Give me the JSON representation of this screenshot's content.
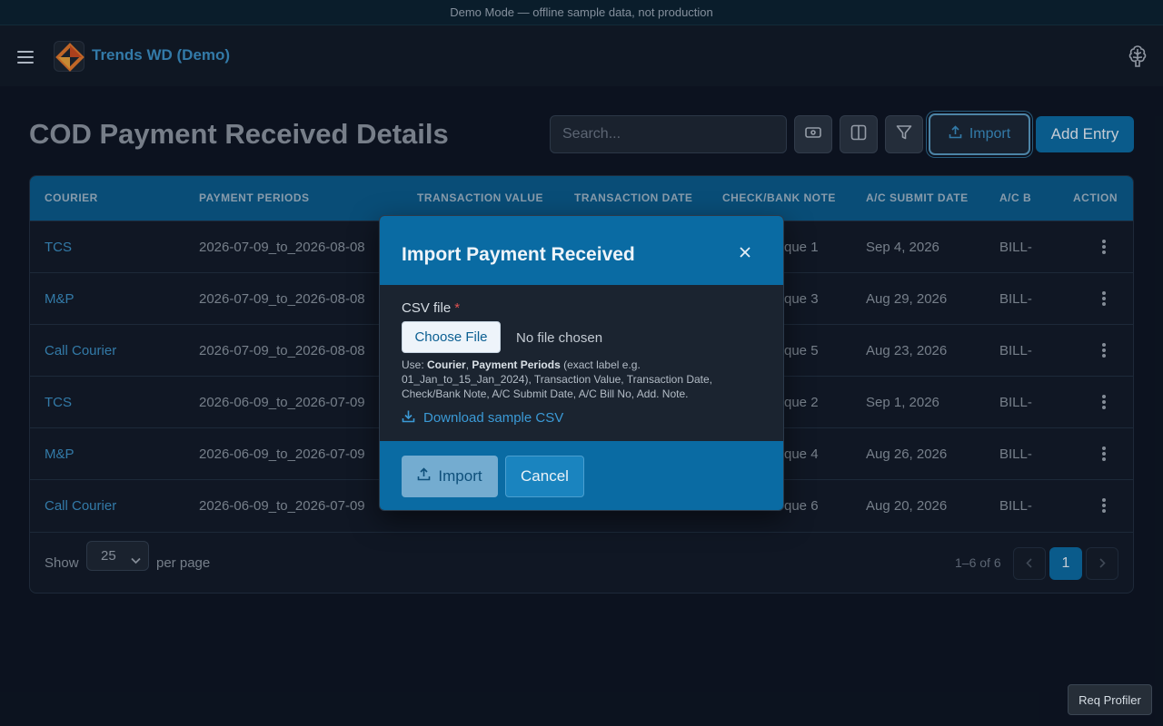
{
  "banner": {
    "text": "Demo Mode — offline sample data, not production"
  },
  "topbar": {
    "app_title": "Trends WD (Demo)",
    "menu_icon": "hamburger-icon",
    "profile_icon": "brain-icon"
  },
  "page": {
    "title": "COD Payment Received Details"
  },
  "toolbar": {
    "search_placeholder": "Search...",
    "buttons": [
      "money-icon",
      "columns-icon",
      "filter-icon"
    ],
    "import_label": "Import",
    "add_entry_label": "Add Entry"
  },
  "table": {
    "columns": [
      "COURIER",
      "PAYMENT PERIODS",
      "TRANSACTION VALUE",
      "TRANSACTION DATE",
      "CHECK/BANK NOTE",
      "A/C SUBMIT DATE",
      "A/C B",
      "ACTION"
    ],
    "rows": [
      {
        "courier": "TCS",
        "period": "2026-07-09_to_2026-08-08",
        "note": "que 1",
        "submit": "Sep 4, 2026",
        "bill": "BILL-("
      },
      {
        "courier": "M&P",
        "period": "2026-07-09_to_2026-08-08",
        "note": "que 3",
        "submit": "Aug 29, 2026",
        "bill": "BILL-("
      },
      {
        "courier": "Call Courier",
        "period": "2026-07-09_to_2026-08-08",
        "note": "que 5",
        "submit": "Aug 23, 2026",
        "bill": "BILL-("
      },
      {
        "courier": "TCS",
        "period": "2026-06-09_to_2026-07-09",
        "note": "que 2",
        "submit": "Sep 1, 2026",
        "bill": "BILL-("
      },
      {
        "courier": "M&P",
        "period": "2026-06-09_to_2026-07-09",
        "note": "que 4",
        "submit": "Aug 26, 2026",
        "bill": "BILL-("
      },
      {
        "courier": "Call Courier",
        "period": "2026-06-09_to_2026-07-09",
        "note": "que 6",
        "submit": "Aug 20, 2026",
        "bill": "BILL-("
      }
    ]
  },
  "pagination": {
    "show_label": "Show",
    "per_page_value": "25",
    "per_page_label": "per page",
    "range": "1–6 of 6",
    "current_page": "1"
  },
  "modal": {
    "title": "Import Payment Received",
    "csv_label": "CSV file",
    "required_mark": "*",
    "choose_file": "Choose File",
    "no_file": "No file chosen",
    "hint_prefix": "Use: ",
    "hint_courier": "Courier",
    "hint_sep": ", ",
    "hint_periods": "Payment Periods",
    "hint_rest": " (exact label e.g. 01_Jan_to_15_Jan_2024), Transaction Value, Transaction Date, Check/Bank Note, A/C Submit Date, A/C Bill No, Add. Note.",
    "download_label": "Download sample CSV",
    "import_label": "Import",
    "cancel_label": "Cancel"
  },
  "profiler": {
    "label": "Req Profiler"
  },
  "colors": {
    "accent": "#0a6ba3",
    "link": "#3b8fc2",
    "background": "#0d1521"
  }
}
